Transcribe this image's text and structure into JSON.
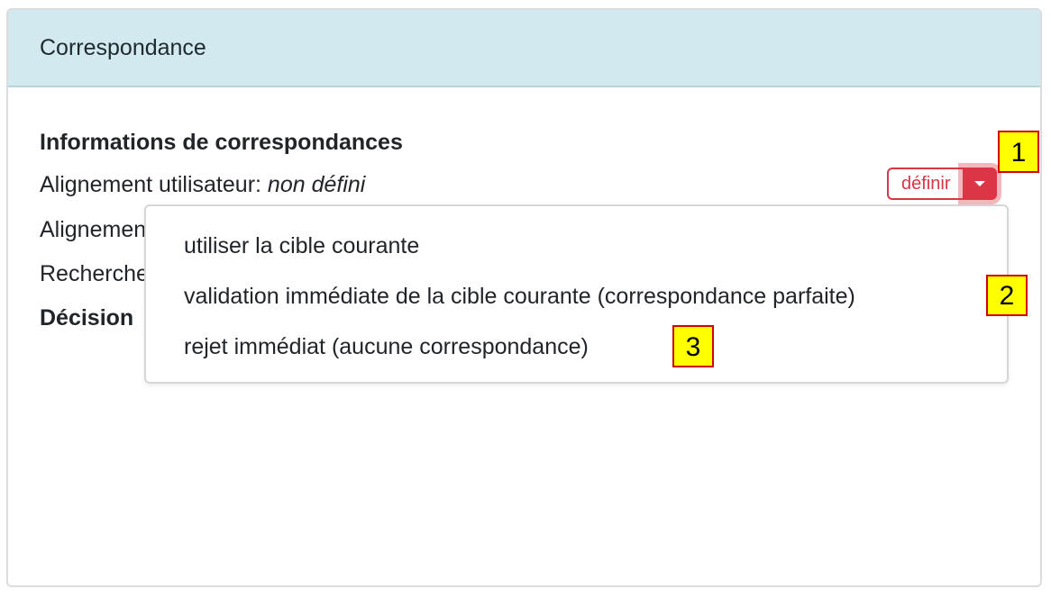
{
  "card": {
    "title": "Correspondance"
  },
  "info": {
    "section_title": "Informations de correspondances",
    "rows": [
      {
        "label": "Alignement utilisateur:",
        "value": "non défini"
      },
      {
        "label": "Alignement"
      },
      {
        "label": "Recherche"
      }
    ],
    "decision_label": "Décision"
  },
  "actions": {
    "define_label": "définir",
    "toggle_icon": "caret-down-icon",
    "accent_color": "#dc3545"
  },
  "dropdown": {
    "items": [
      "utiliser la cible courante",
      "validation immédiate de la cible courante (correspondance parfaite)",
      "rejet immédiat (aucune correspondance)"
    ]
  },
  "markers": [
    "1",
    "2",
    "3"
  ]
}
